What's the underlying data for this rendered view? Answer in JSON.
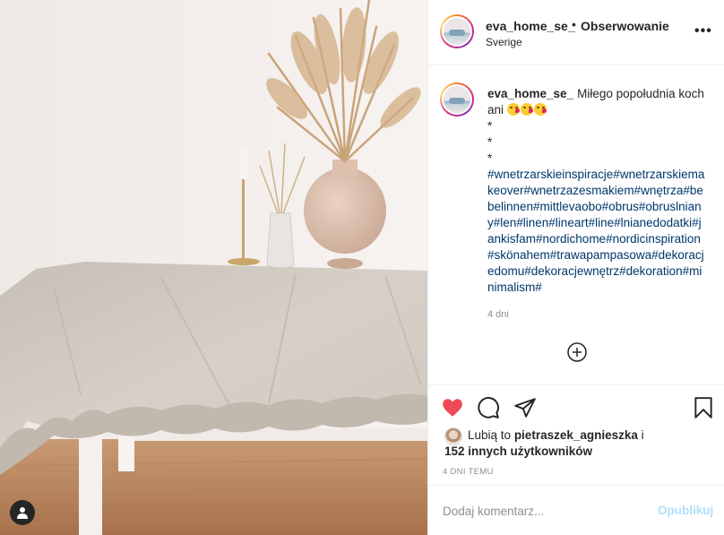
{
  "post": {
    "username": "eva_home_se_",
    "separator": "•",
    "follow_label": "Obserwowanie",
    "location": "Sverige",
    "more_label": "•••"
  },
  "caption": {
    "username": "eva_home_se_",
    "text": "Miłego popołudnia kochani",
    "emoji": [
      "face-blowing-kiss",
      "face-blowing-kiss",
      "face-blowing-kiss"
    ],
    "stars": [
      "*",
      "*",
      "*"
    ],
    "hashtags": "#wnetrzarskieinspiracje#wnetrzarskiemakeover#wnetrzazesmakiem#wnętrza#bebelinnen#mittlevaobo#obrus#obruslniany#len#linen#lineart#line#lnianedodatki#jankisfam#nordichome#nordicinspiration#skönahem#trawapampasowa#dekoracjedomu#dekoracjewnętrz#dekoration#minimalism#",
    "age": "4 dni"
  },
  "actions": {
    "liked": true,
    "like_color": "#ed4956"
  },
  "likes": {
    "prefix": "Lubią to",
    "first_user": "pietraszek_agnieszka",
    "conjunction": "i",
    "others": "152 innych użytkowników"
  },
  "date": "4 DNI TEMU",
  "comment": {
    "placeholder": "Dodaj komentarz...",
    "publish_label": "Opublikuj"
  },
  "colors": {
    "hashtag": "#00376b",
    "publish_disabled": "#b2dffc",
    "muted": "#8e8e8e"
  }
}
